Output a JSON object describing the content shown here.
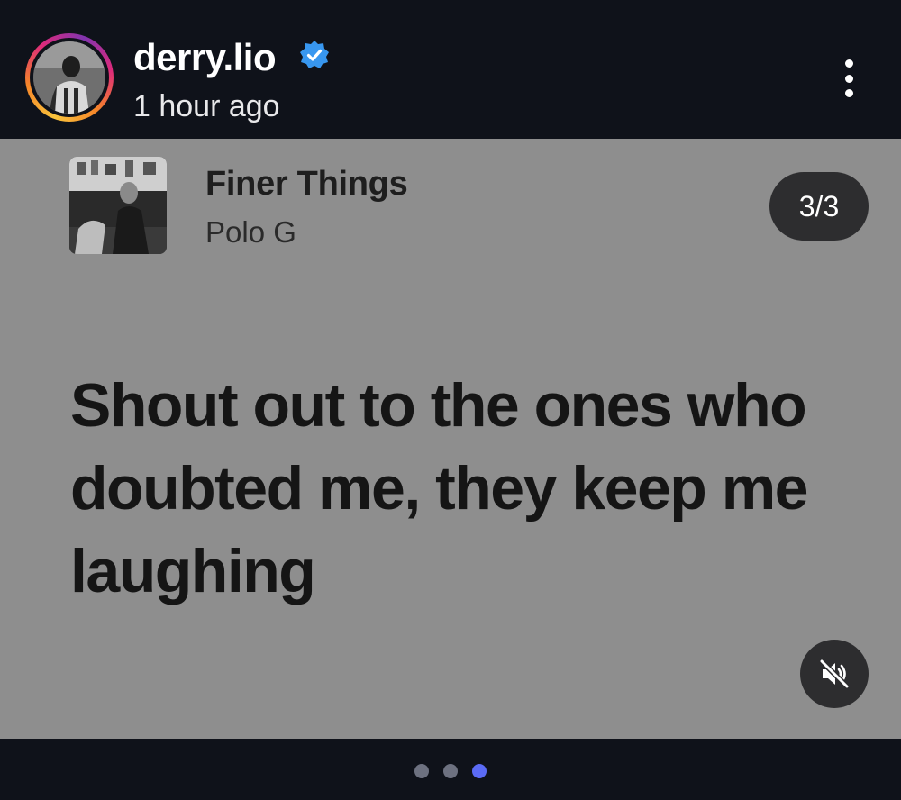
{
  "post": {
    "username": "derry.lio",
    "verified": true,
    "timestamp": "1 hour ago",
    "more_icon": "more-vertical-icon"
  },
  "card": {
    "song_title": "Finer Things",
    "artist": "Polo G",
    "page_indicator": "3/3",
    "lyrics": "Shout out to the ones who doubted me, they keep me laughing",
    "mute_icon": "volume-muted-icon"
  },
  "carousel": {
    "total": 3,
    "active_index": 2
  },
  "colors": {
    "background": "#0f121a",
    "card_background": "#8e8e8e",
    "verified_badge": "#3897f0",
    "active_dot": "#5b6bf5",
    "inactive_dot": "#6d7180"
  }
}
